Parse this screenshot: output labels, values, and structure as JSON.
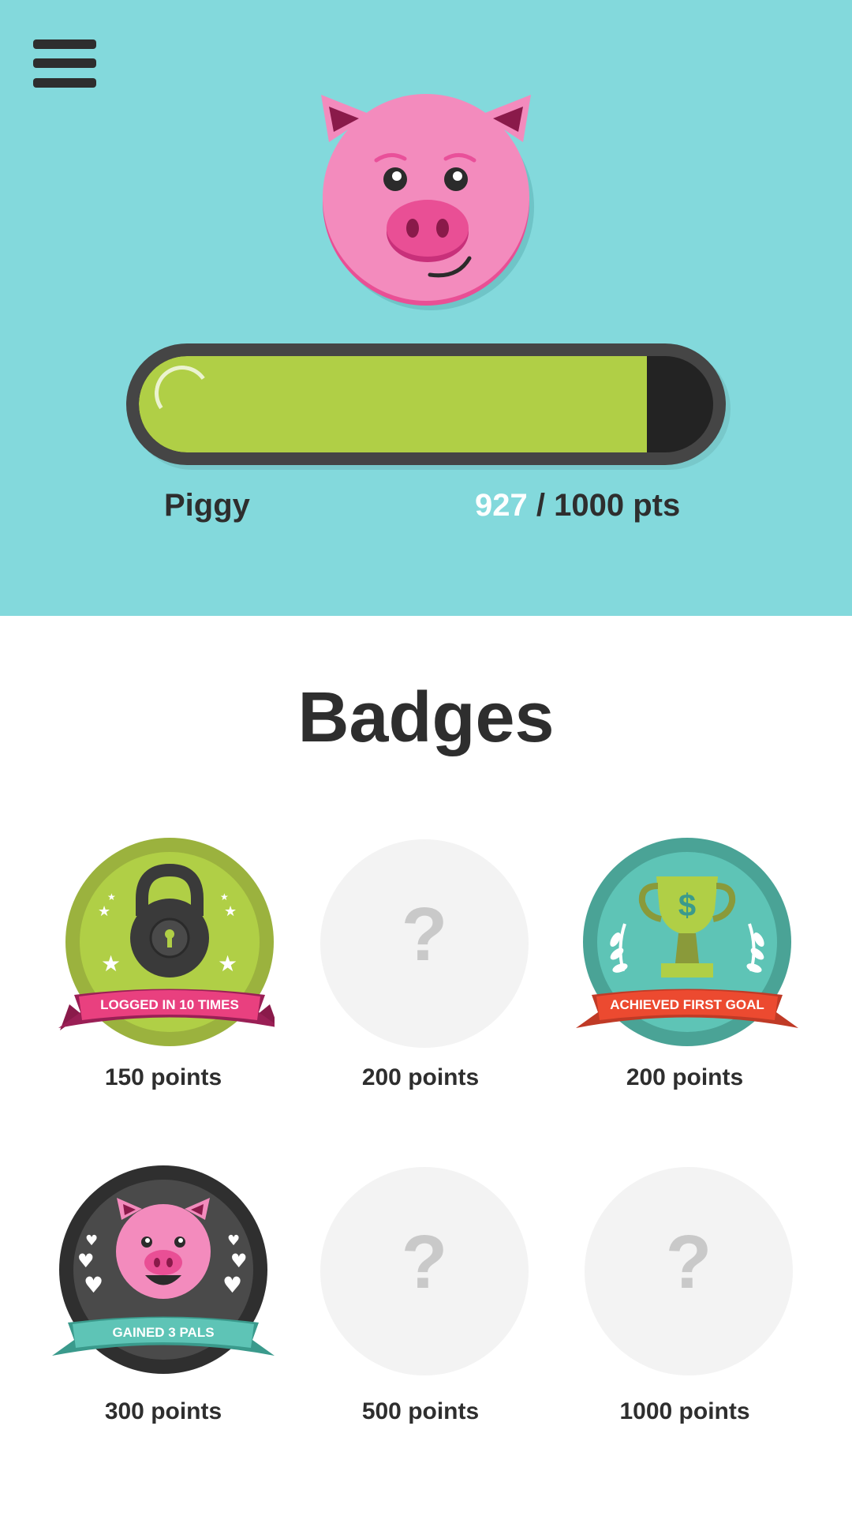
{
  "header": {
    "pet_name": "Piggy",
    "points_current": "927",
    "points_rest": " / 1000 pts",
    "progress": {
      "current": 927,
      "max": 1000
    },
    "colors": {
      "background": "#83d9dc",
      "bar_fill": "#b0cf46",
      "pig_pink": "#f38bbd"
    }
  },
  "badges_section": {
    "title": "Badges",
    "badges": [
      {
        "ribbon_text": "LOGGED IN 10 TIMES",
        "points_label": "150 points",
        "unlocked": true,
        "icon": "padlock-icon"
      },
      {
        "ribbon_text": "",
        "points_label": "200 points",
        "unlocked": false,
        "locked_symbol": "?"
      },
      {
        "ribbon_text": "ACHIEVED FIRST GOAL",
        "points_label": "200 points",
        "unlocked": true,
        "icon": "trophy-icon"
      },
      {
        "ribbon_text": "GAINED 3 PALS",
        "points_label": "300 points",
        "unlocked": true,
        "icon": "pig-icon"
      },
      {
        "ribbon_text": "",
        "points_label": "500 points",
        "unlocked": false,
        "locked_symbol": "?"
      },
      {
        "ribbon_text": "",
        "points_label": "1000 points",
        "unlocked": false,
        "locked_symbol": "?"
      }
    ]
  }
}
